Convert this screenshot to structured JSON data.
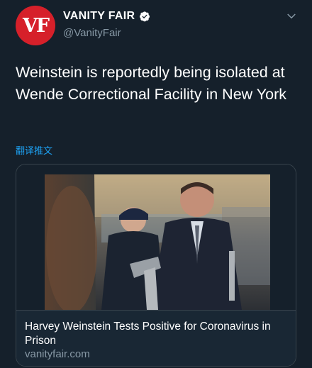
{
  "author": {
    "display_name": "VANITY FAIR",
    "handle": "@VanityFair",
    "avatar_text": "VF",
    "verified": true
  },
  "tweet": {
    "text": "Weinstein is reportedly being isolated at Wende Correctional Facility in New York",
    "translate_label": "翻译推文"
  },
  "card": {
    "title": "Harvey Weinstein Tests Positive for Coronavirus in Prison",
    "domain": "vanityfair.com",
    "image_icon": "news-photo"
  },
  "icons": {
    "verified": "verified-badge-icon",
    "menu": "chevron-down-icon"
  },
  "colors": {
    "background": "#15202b",
    "accent": "#1da1f2",
    "avatar": "#d6202a",
    "secondary_text": "#8899a6",
    "border": "#38444d"
  }
}
